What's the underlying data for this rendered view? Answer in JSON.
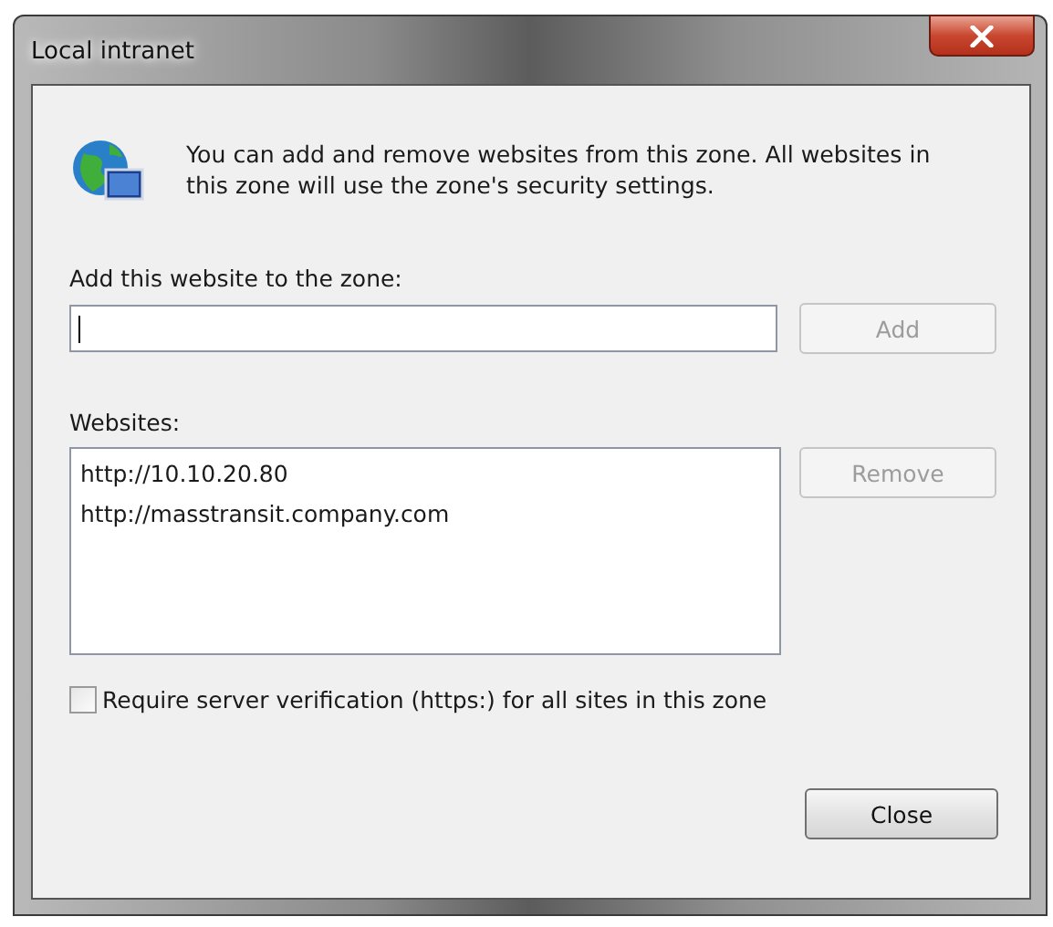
{
  "window": {
    "title": "Local intranet"
  },
  "description": "You can add and remove websites from this zone. All websites in this zone will use the zone's security settings.",
  "add_field": {
    "label": "Add this website to the zone:"
  },
  "add_button": {
    "label": "Add",
    "disabled": true
  },
  "websites": {
    "label": "Websites:",
    "items": [
      {
        "text": "http://10.10.20.80",
        "selected": false
      },
      {
        "text": "http://masstransit.company.com",
        "selected": false
      }
    ]
  },
  "remove_button": {
    "label": "Remove",
    "disabled": true
  },
  "require_verification": {
    "label": "Require server verification (https:) for all sites in this zone",
    "checked": false
  },
  "buttons": [
    {
      "label": "Close",
      "disabled": false
    }
  ]
}
